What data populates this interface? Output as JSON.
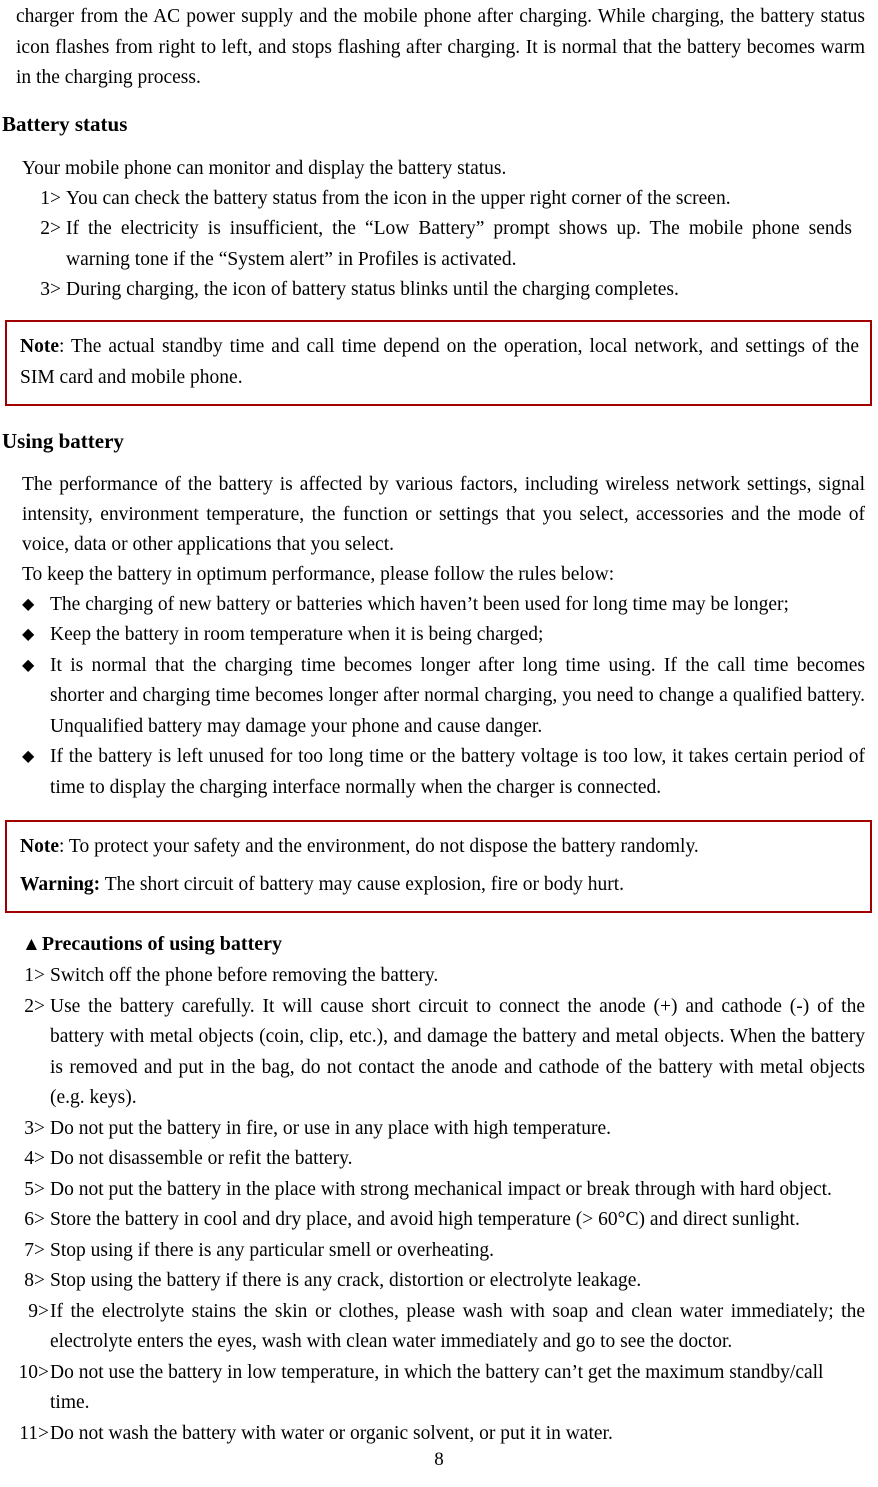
{
  "document": {
    "page_number": "8",
    "accent_border_color": "#a00000",
    "text_color": "#000000",
    "background_color": "#ffffff"
  },
  "top_paragraph": "charger from the AC power supply and the mobile phone after charging. While charging, the battery status icon flashes from right to left, and stops flashing after charging. It is normal that the battery becomes warm in the charging process.",
  "battery_status": {
    "heading": "Battery status",
    "intro": "Your mobile phone can monitor and display the battery status.",
    "items": [
      {
        "marker": "1>",
        "text": "You can check the battery status from the icon in the upper right corner of the screen."
      },
      {
        "marker": "2>",
        "text": "If the electricity is insufficient, the “Low Battery” prompt shows up. The mobile phone sends warning tone if the “System alert” in Profiles is activated."
      },
      {
        "marker": "3>",
        "text": "During charging, the icon of battery status blinks until the charging completes."
      }
    ],
    "note": {
      "lead": "Note",
      "text": ": The actual standby time and call time depend on the operation, local network, and settings of the SIM card and mobile phone."
    }
  },
  "using_battery": {
    "heading": "Using battery",
    "paragraph_1": "The performance of the battery is affected by various factors, including wireless network settings, signal intensity, environment temperature, the function or settings that you select, accessories and the mode of voice, data or other applications that you select.",
    "paragraph_2": "To keep the battery in optimum performance, please follow the rules below:",
    "bullet_icon": "◆",
    "bullets": [
      "The charging of new battery or batteries which haven’t been used for long time may be longer;",
      "Keep the battery in room temperature when it is being charged;",
      "It is normal that the charging time becomes longer after long time using. If the call time becomes shorter and charging time becomes longer after normal charging, you need to change a qualified battery. Unqualified battery may damage your phone and cause danger.",
      "If the battery is left unused for too long time or the battery voltage is too low, it takes certain period of time to display the charging interface normally when the charger is connected."
    ],
    "note": {
      "lead_1": "Note",
      "text_1": ": To protect your safety and the environment, do not dispose the battery randomly.",
      "lead_2": "Warning:",
      "text_2": " The short circuit of battery may cause explosion, fire or body hurt."
    }
  },
  "precautions": {
    "triangle_icon": "▲",
    "heading": "Precautions of using battery",
    "items": [
      {
        "marker": "1>",
        "text": "Switch off the phone before removing the battery."
      },
      {
        "marker": "2>",
        "text": "Use the battery carefully. It will cause short circuit to connect the anode (+) and cathode (-) of the battery with metal objects (coin, clip, etc.), and damage the battery and metal objects. When the battery is removed and put in the bag, do not contact the anode and cathode of the battery with metal objects (e.g. keys)."
      },
      {
        "marker": "3>",
        "text": "Do not put the battery in fire, or use in any place with high temperature."
      },
      {
        "marker": "4>",
        "text": "Do not disassemble or refit the battery."
      },
      {
        "marker": "5>",
        "text": "Do not put the battery in the place with strong mechanical impact or break through with hard object."
      },
      {
        "marker": "6>",
        "text": "Store the battery in cool and dry place, and avoid high temperature (> 60°C) and direct sunlight."
      },
      {
        "marker": "7>",
        "text": "Stop using if there is any particular smell or overheating."
      },
      {
        "marker": "8>",
        "text": "Stop using the battery if there is any crack, distortion or electrolyte leakage."
      },
      {
        "marker": "9>",
        "text": "If the electrolyte stains the skin or clothes, please wash with soap and clean water immediately; the electrolyte enters the eyes, wash with clean water immediately and go to see the doctor."
      },
      {
        "marker": "10>",
        "text": "Do not use the battery in low temperature, in which the battery can’t get the maximum standby/call time."
      },
      {
        "marker": "11>",
        "text": "Do not wash the battery with water or organic solvent, or put it in water."
      }
    ]
  }
}
